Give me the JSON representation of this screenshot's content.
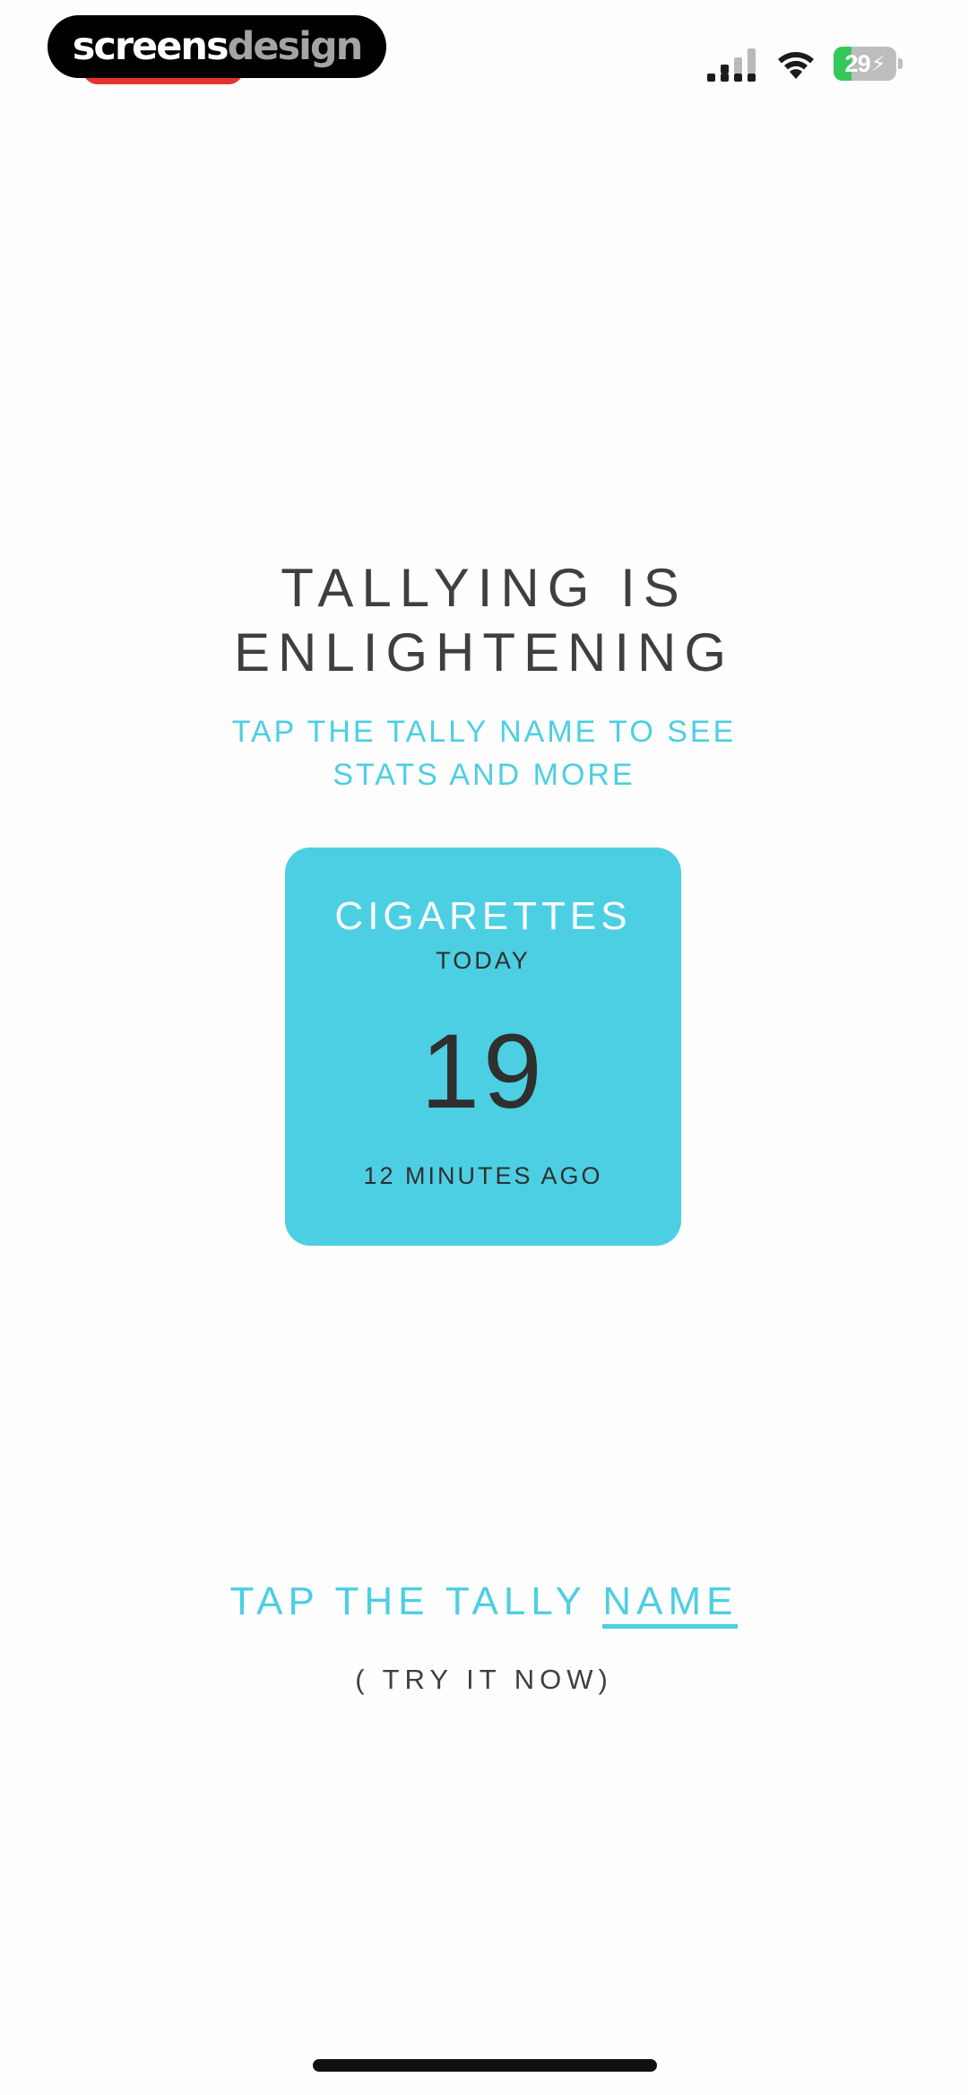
{
  "watermark": {
    "part1": "screens",
    "part2": "design"
  },
  "status_bar": {
    "battery_level": "29",
    "battery_percent": 29,
    "icons": [
      "cellular-signal-icon",
      "wifi-icon",
      "battery-charging-icon"
    ],
    "recording_indicator_color": "#e5322d"
  },
  "onboarding": {
    "headline_line1": "TALLYING IS",
    "headline_line2": "ENLIGHTENING",
    "subhead_line1": "TAP THE TALLY NAME TO SEE",
    "subhead_line2": "STATS AND MORE"
  },
  "tally_card": {
    "name": "CIGARETTES",
    "period": "TODAY",
    "count": "19",
    "last_updated": "12 MINUTES AGO"
  },
  "cta": {
    "prefix": "TAP THE TALLY ",
    "link": "NAME",
    "sub": "( TRY IT NOW)"
  },
  "colors": {
    "accent": "#4ccfe2",
    "text_dark": "#3f3f3f",
    "background": "#fefefe"
  }
}
